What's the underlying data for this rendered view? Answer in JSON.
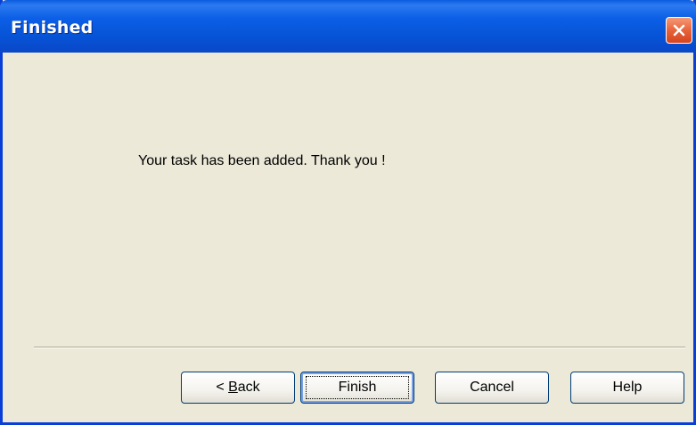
{
  "window": {
    "title": "Finished"
  },
  "icons": {
    "close": "close-icon"
  },
  "content": {
    "message": "Your task has been added. Thank you !"
  },
  "buttons": {
    "back_prefix": "< ",
    "back_mnemonic": "B",
    "back_rest": "ack",
    "finish": "Finish",
    "cancel": "Cancel",
    "help": "Help"
  },
  "colors": {
    "titlebar": "#0653d6",
    "dialog_bg": "#ece9d8",
    "close_button": "#e8633a"
  }
}
